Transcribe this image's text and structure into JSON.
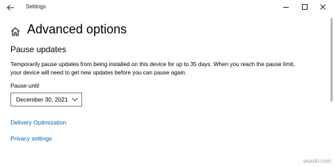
{
  "window": {
    "title": "Settings",
    "controls": [
      "minimize-icon",
      "maximize-icon",
      "close-icon"
    ]
  },
  "header": {
    "icon": "home-icon",
    "title": "Advanced options"
  },
  "pause_section": {
    "heading": "Pause updates",
    "description_line1": "Temporarily pause updates from being installed on this device for up to 35 days. When you reach the pause limit,",
    "description_line2": "your device will need to get new updates before you can pause again.",
    "pause_until_label": "Pause until",
    "selected_date": "December 30, 2021"
  },
  "links": {
    "delivery_optimization": "Delivery Optimization",
    "privacy_settings": "Privacy settings"
  },
  "watermark": "wsxdn.com",
  "colors": {
    "link": "#0066b4",
    "background": "#ffffff",
    "text": "#000000"
  }
}
